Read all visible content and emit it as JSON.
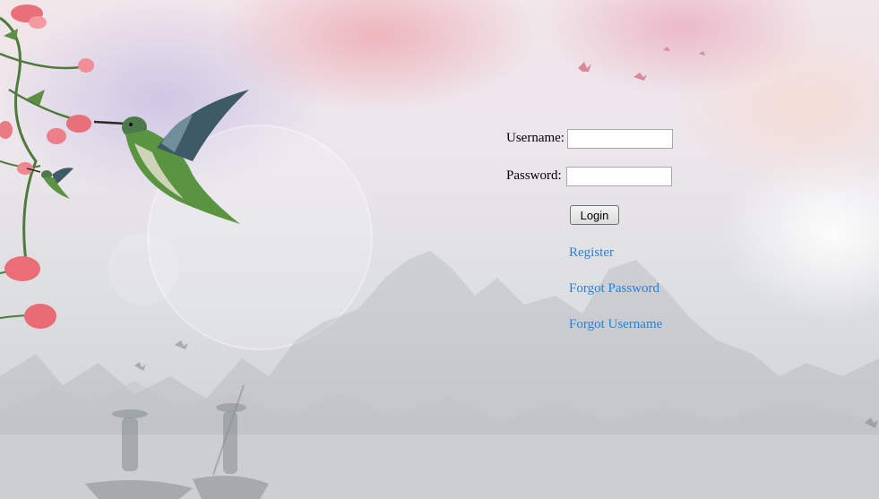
{
  "login_form": {
    "username_label": "Username:",
    "username_value": "",
    "password_label": "Password:",
    "password_value": "",
    "login_button": "Login"
  },
  "links": {
    "register": "Register",
    "forgot_password": "Forgot Password",
    "forgot_username": "Forgot Username"
  },
  "colors": {
    "link": "#2a7fd4"
  },
  "background": {
    "scene": [
      "hummingbird-icon",
      "flower-icon",
      "mountain-icon",
      "fisherman-icon",
      "bird-icon"
    ]
  }
}
